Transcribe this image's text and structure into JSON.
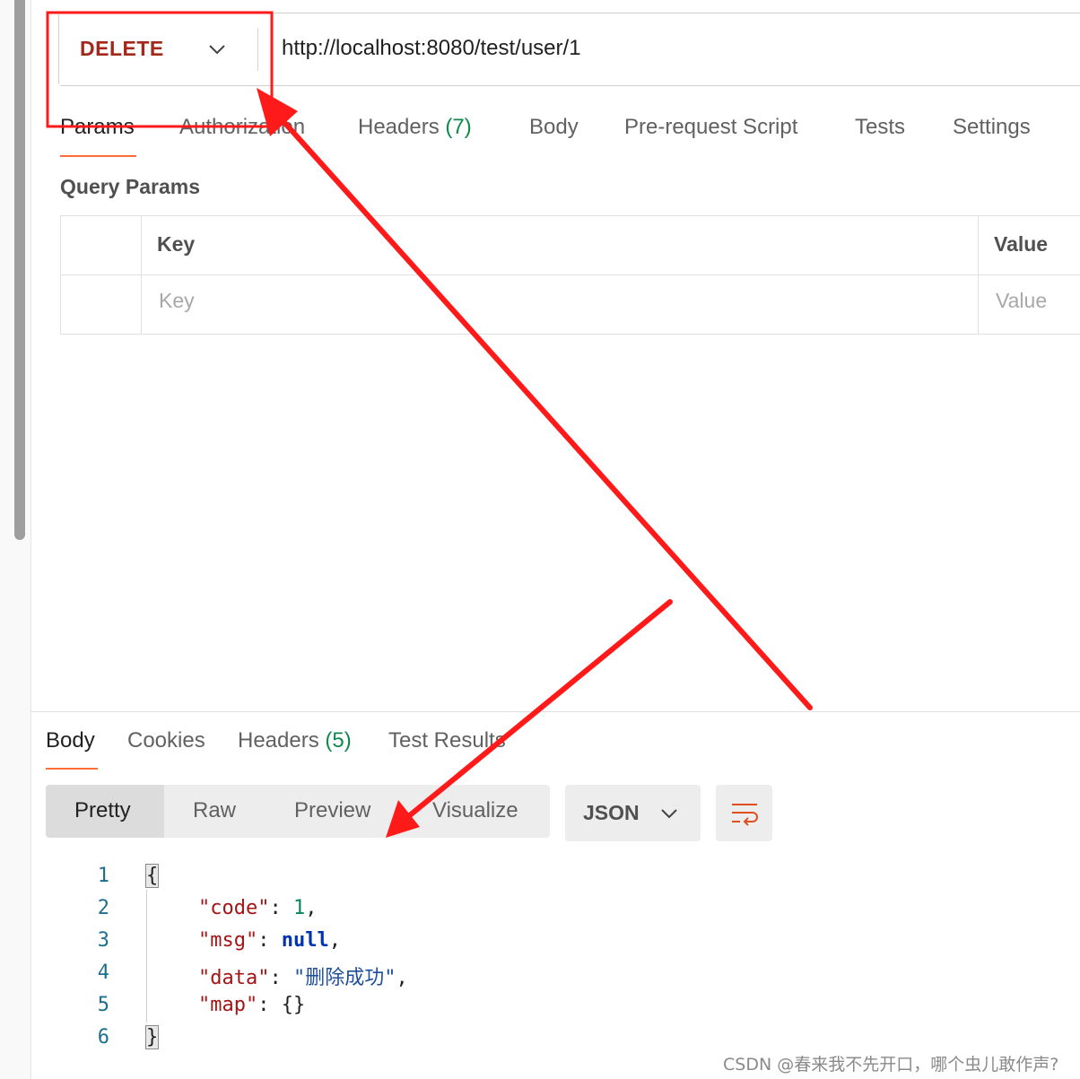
{
  "request": {
    "method": "DELETE",
    "url": "http://localhost:8080/test/user/1",
    "tabs": [
      {
        "label": "Params",
        "active": true
      },
      {
        "label": "Authorization"
      },
      {
        "label": "Headers",
        "count": "(7)"
      },
      {
        "label": "Body"
      },
      {
        "label": "Pre-request Script"
      },
      {
        "label": "Tests"
      },
      {
        "label": "Settings"
      }
    ]
  },
  "query_params": {
    "title": "Query Params",
    "columns": [
      "Key",
      "Value"
    ],
    "placeholders": {
      "key": "Key",
      "value": "Value"
    }
  },
  "response": {
    "tabs": [
      {
        "label": "Body",
        "active": true
      },
      {
        "label": "Cookies"
      },
      {
        "label": "Headers",
        "count": "(5)"
      },
      {
        "label": "Test Results"
      }
    ],
    "view_modes": [
      "Pretty",
      "Raw",
      "Preview",
      "Visualize"
    ],
    "active_view": "Pretty",
    "format": "JSON",
    "wrap_icon": "wrap-lines-icon",
    "code": {
      "line_numbers": [
        "1",
        "2",
        "3",
        "4",
        "5",
        "6"
      ],
      "open_brace": "{",
      "close_brace": "}",
      "entries": [
        {
          "key": "\"code\"",
          "sep": ": ",
          "value": "1",
          "trail": ",",
          "type": "number"
        },
        {
          "key": "\"msg\"",
          "sep": ": ",
          "value": "null",
          "trail": ",",
          "type": "keyword"
        },
        {
          "key": "\"data\"",
          "sep": ": ",
          "value": "\"删除成功\"",
          "trail": ",",
          "type": "string"
        },
        {
          "key": "\"map\"",
          "sep": ": ",
          "value": "{}",
          "trail": "",
          "type": "plain"
        }
      ]
    }
  },
  "watermark": "CSDN @春来我不先开口，哪个虫儿敢作声?",
  "colors": {
    "method": "#a3281c",
    "active_tab_underline": "#ff6c37",
    "count": "#0d8a4c",
    "annotation": "#ff1a1a"
  }
}
